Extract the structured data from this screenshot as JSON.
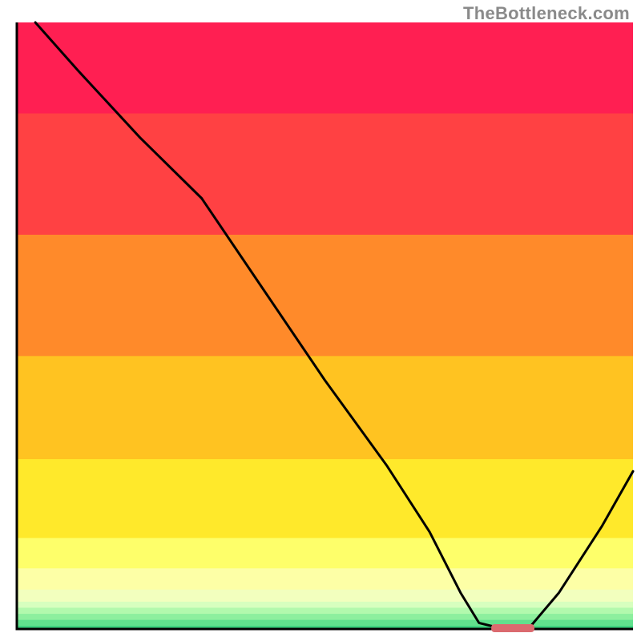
{
  "watermark": "TheBottleneck.com",
  "chart_data": {
    "type": "line",
    "title": "",
    "xlabel": "",
    "ylabel": "",
    "xlim": [
      0,
      100
    ],
    "ylim": [
      0,
      100
    ],
    "grid": false,
    "series": [
      {
        "name": "bottleneck-curve",
        "x": [
          3,
          10,
          20,
          30,
          40,
          50,
          60,
          67,
          72,
          75,
          79,
          83,
          88,
          95,
          100
        ],
        "values": [
          100,
          92,
          81,
          71,
          56,
          41,
          27,
          16,
          6,
          1,
          0,
          0,
          6,
          17,
          26
        ],
        "color": "#000000"
      }
    ],
    "marker": {
      "name": "optimal-range",
      "x_start": 77,
      "x_end": 84,
      "y": 0,
      "color": "#db6a6f"
    },
    "background_gradient": {
      "type": "vertical-stepped",
      "stops": [
        {
          "y_pct": 0.0,
          "color": "#ff1f52"
        },
        {
          "y_pct": 0.15,
          "color": "#ff4143"
        },
        {
          "y_pct": 0.35,
          "color": "#ff8a2a"
        },
        {
          "y_pct": 0.55,
          "color": "#ffc321"
        },
        {
          "y_pct": 0.72,
          "color": "#ffe92b"
        },
        {
          "y_pct": 0.85,
          "color": "#feff6a"
        },
        {
          "y_pct": 0.9,
          "color": "#fdffa6"
        },
        {
          "y_pct": 0.935,
          "color": "#f2ffbe"
        },
        {
          "y_pct": 0.955,
          "color": "#d7ffbf"
        },
        {
          "y_pct": 0.965,
          "color": "#b2f9ad"
        },
        {
          "y_pct": 0.975,
          "color": "#8def9e"
        },
        {
          "y_pct": 0.985,
          "color": "#61e18d"
        },
        {
          "y_pct": 0.995,
          "color": "#3bd17e"
        },
        {
          "y_pct": 1.0,
          "color": "#20c673"
        }
      ]
    }
  }
}
